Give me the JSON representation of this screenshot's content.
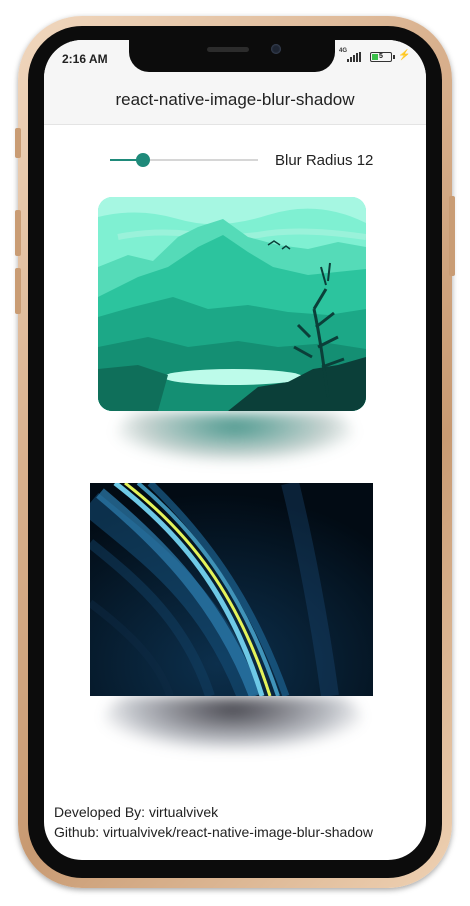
{
  "status_bar": {
    "time": "2:16 AM",
    "network": "4G",
    "battery_level": "5",
    "battery_color": "#3cc04a"
  },
  "header": {
    "title": "react-native-image-blur-shadow"
  },
  "blur_control": {
    "label": "Blur Radius 12",
    "value": 12,
    "slider_fraction": 0.22,
    "accent_color": "#1f8a7a"
  },
  "images": [
    {
      "name": "mountain-landscape-image",
      "shadow_color": "#1f8a7a"
    },
    {
      "name": "abstract-light-streaks-image",
      "shadow_color": "#141820"
    }
  ],
  "footer": {
    "developer": "Developed By: virtualvivek",
    "github": "Github: virtualvivek/react-native-image-blur-shadow"
  }
}
